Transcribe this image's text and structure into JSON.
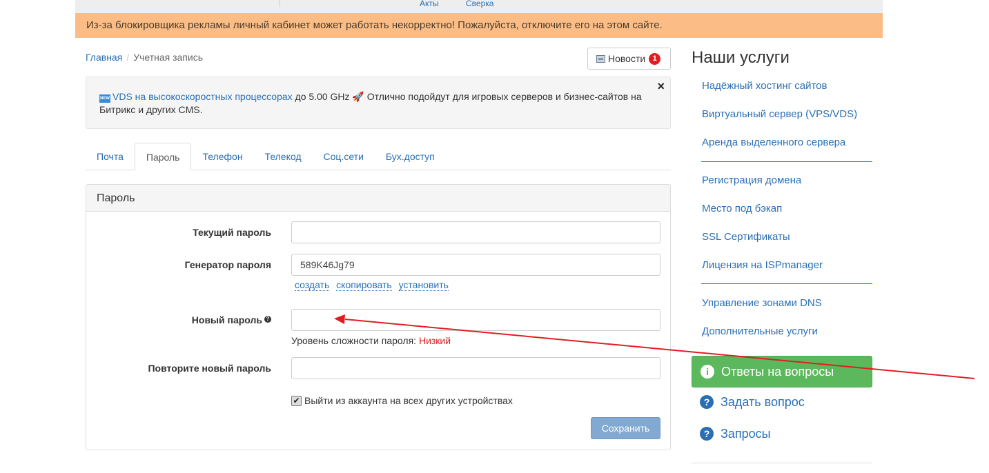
{
  "topbar": {
    "links": [
      "Акты",
      "Сверка"
    ]
  },
  "adblock": {
    "text": "Из-за блокировщика рекламы личный кабинет может работать некорректно! Пожалуйста, отключите его на этом сайте."
  },
  "breadcrumb": {
    "home": "Главная",
    "divider": "/",
    "current": "Учетная запись"
  },
  "news": {
    "label": "Новости",
    "count": "1"
  },
  "promo": {
    "badge": "NEW",
    "link": "VDS на высокоскоростных процессорах",
    "rest": " до 5.00 GHz 🚀 Отлично подойдут для игровых серверов и бизнес-сайтов на Битрикс и других CMS.",
    "close": "×"
  },
  "tabs": [
    "Почта",
    "Пароль",
    "Телефон",
    "Телекод",
    "Соц.сети",
    "Бух.доступ"
  ],
  "panel": {
    "title": "Пароль",
    "current_password_label": "Текущий пароль",
    "current_password_value": "",
    "generator_label": "Генератор пароля",
    "generator_value": "589K46Jg79",
    "gen_links": [
      "создать",
      "скопировать",
      "установить"
    ],
    "new_password_label": "Новый пароль",
    "help_icon": "?",
    "new_password_value": "",
    "strength_label": "Уровень сложности пароля:",
    "strength_value": "Низкий",
    "repeat_label": "Повторите новый пароль",
    "repeat_value": "",
    "logout_checkbox_label": "Выйти из аккаунта на всех других устройствах",
    "logout_checked": true,
    "save_label": "Сохранить"
  },
  "sidebar": {
    "title": "Наши услуги",
    "services_group1": [
      "Надёжный хостинг сайтов",
      "Виртуальный сервер (VPS/VDS)",
      "Аренда выделенного сервера"
    ],
    "services_group2": [
      "Регистрация домена",
      "Место под бэкап",
      "SSL Сертификаты",
      "Лицензия на ISPmanager"
    ],
    "services_group3": [
      "Управление зонами DNS",
      "Дополнительные услуги"
    ],
    "faq_label": "Ответы на вопросы",
    "ask_label": "Задать вопрос",
    "requests_label": "Запросы"
  },
  "colors": {
    "accent": "#2a6fb4",
    "warning_bg": "#fbbd85",
    "success": "#5cb85c",
    "annotation": "#e21d22"
  },
  "icons": [
    "news-icon",
    "new-badge-icon",
    "rocket-icon",
    "close-icon",
    "help-icon",
    "info-icon",
    "question-icon"
  ]
}
